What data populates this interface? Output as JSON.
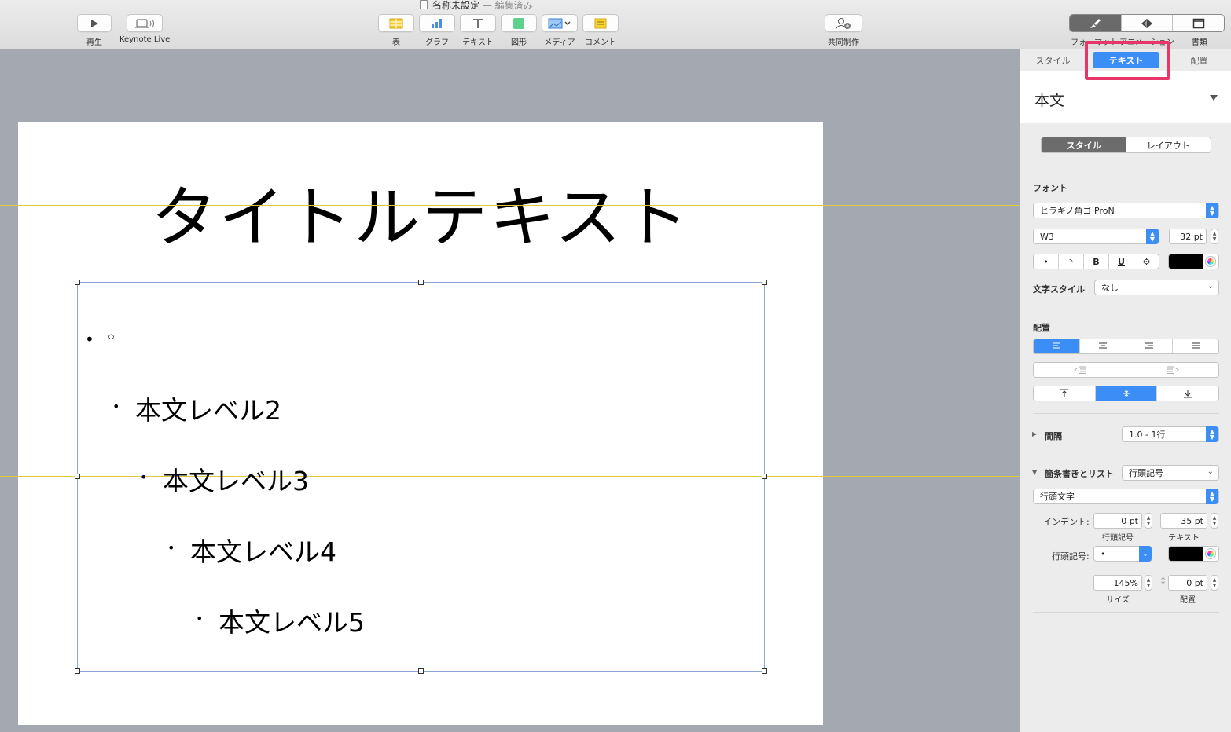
{
  "window": {
    "title": "名称未設定",
    "subtitle": "— 編集済み"
  },
  "toolbar": {
    "play_label": "再生",
    "keynote_live_label": "Keynote Live",
    "table_label": "表",
    "chart_label": "グラフ",
    "text_label": "テキスト",
    "shape_label": "図形",
    "media_label": "メディア",
    "comment_label": "コメント",
    "collaborate_label": "共同制作",
    "format_label": "フォーマット",
    "animate_label": "アニメーション",
    "document_label": "書類"
  },
  "slide": {
    "title": "タイトルテキスト",
    "bullets": [
      {
        "bullet": "•",
        "text": "◦"
      },
      {
        "bullet": "•",
        "text": "本文レベル2"
      },
      {
        "bullet": "•",
        "text": "本文レベル3"
      },
      {
        "bullet": "•",
        "text": "本文レベル4"
      },
      {
        "bullet": "•",
        "text": "本文レベル5"
      }
    ]
  },
  "inspector": {
    "tabs": [
      "スタイル",
      "テキスト",
      "配置"
    ],
    "active_tab": "テキスト",
    "paragraph_style": "本文",
    "subtabs": [
      "スタイル",
      "レイアウト"
    ],
    "font_section": "フォント",
    "font_family": "ヒラギノ角ゴ ProN",
    "font_weight": "W3",
    "font_size": "32 pt",
    "format_buttons": [
      "•",
      "◝",
      "B",
      "U",
      "⚙"
    ],
    "text_color": "#000000",
    "char_style_label": "文字スタイル",
    "char_style_value": "なし",
    "alignment_section": "配置",
    "spacing_label": "間隔",
    "spacing_value": "1.0 - 1行",
    "bullets_label": "箇条書きとリスト",
    "bullets_value": "行頭記号",
    "bullet_type": "行頭文字",
    "indent_label": "インデント:",
    "indent_bullet": "0 pt",
    "indent_text": "35 pt",
    "indent_bullet_cap": "行頭記号",
    "indent_text_cap": "テキスト",
    "bullet_char_label": "行頭記号:",
    "bullet_char_value": "•",
    "bullet_color": "#000000",
    "size_value": "145%",
    "align_value": "0 pt",
    "size_cap": "サイズ",
    "align_cap": "配置"
  },
  "colors": {
    "accent": "#3b8ef6",
    "highlight": "#e8366b",
    "guide": "#e0cc3a"
  }
}
